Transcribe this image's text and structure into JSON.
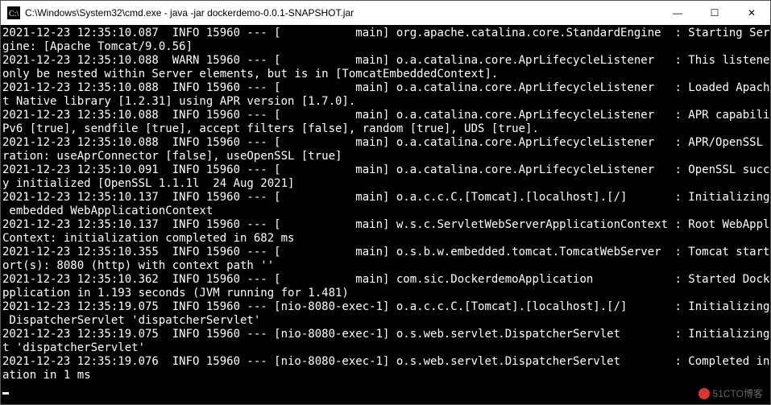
{
  "window": {
    "title": "C:\\Windows\\System32\\cmd.exe - java  -jar dockerdemo-0.0.1-SNAPSHOT.jar"
  },
  "icons": {
    "app": "cmd-icon",
    "minimize": "—",
    "maximize": "☐",
    "close": "✕"
  },
  "log_lines": [
    "2021-12-23 12:35:10.087  INFO 15960 --- [           main] org.apache.catalina.core.StandardEngine  : Starting Servlet en",
    "gine: [Apache Tomcat/9.0.56]",
    "2021-12-23 12:35:10.088  WARN 15960 --- [           main] o.a.catalina.core.AprLifecycleListener   : This listener must ",
    "only be nested within Server elements, but is in [TomcatEmbeddedContext].",
    "2021-12-23 12:35:10.088  INFO 15960 --- [           main] o.a.catalina.core.AprLifecycleListener   : Loaded Apache Tomca",
    "t Native library [1.2.31] using APR version [1.7.0].",
    "2021-12-23 12:35:10.088  INFO 15960 --- [           main] o.a.catalina.core.AprLifecycleListener   : APR capabilities: I",
    "Pv6 [true], sendfile [true], accept filters [false], random [true], UDS [true].",
    "2021-12-23 12:35:10.088  INFO 15960 --- [           main] o.a.catalina.core.AprLifecycleListener   : APR/OpenSSL configu",
    "ration: useAprConnector [false], useOpenSSL [true]",
    "2021-12-23 12:35:10.091  INFO 15960 --- [           main] o.a.catalina.core.AprLifecycleListener   : OpenSSL successfull",
    "y initialized [OpenSSL 1.1.1l  24 Aug 2021]",
    "2021-12-23 12:35:10.137  INFO 15960 --- [           main] o.a.c.c.C.[Tomcat].[localhost].[/]       : Initializing Spring",
    " embedded WebApplicationContext",
    "2021-12-23 12:35:10.137  INFO 15960 --- [           main] w.s.c.ServletWebServerApplicationContext : Root WebApplication",
    "Context: initialization completed in 682 ms",
    "2021-12-23 12:35:10.355  INFO 15960 --- [           main] o.s.b.w.embedded.tomcat.TomcatWebServer  : Tomcat started on p",
    "ort(s): 8080 (http) with context path ''",
    "2021-12-23 12:35:10.362  INFO 15960 --- [           main] com.sic.DockerdemoApplication            : Started DockerdemoA",
    "pplication in 1.193 seconds (JVM running for 1.481)",
    "2021-12-23 12:35:19.075  INFO 15960 --- [nio-8080-exec-1] o.a.c.c.C.[Tomcat].[localhost].[/]       : Initializing Spring",
    " DispatcherServlet 'dispatcherServlet'",
    "2021-12-23 12:35:19.075  INFO 15960 --- [nio-8080-exec-1] o.s.web.servlet.DispatcherServlet        : Initializing Servle",
    "t 'dispatcherServlet'",
    "2021-12-23 12:35:19.076  INFO 15960 --- [nio-8080-exec-1] o.s.web.servlet.DispatcherServlet        : Completed initializ",
    "ation in 1 ms"
  ],
  "watermark": "51CTO博客"
}
